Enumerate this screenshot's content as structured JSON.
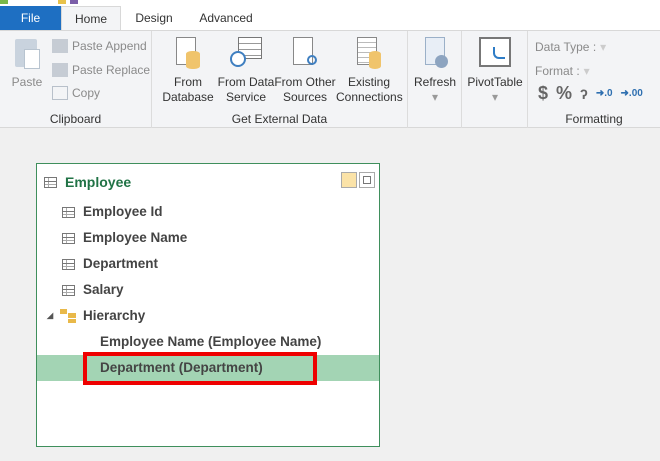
{
  "tabs": {
    "file": "File",
    "home": "Home",
    "design": "Design",
    "advanced": "Advanced"
  },
  "clipboard": {
    "paste": "Paste",
    "paste_append": "Paste Append",
    "paste_replace": "Paste Replace",
    "copy": "Copy",
    "label": "Clipboard"
  },
  "external": {
    "from_database": [
      "From",
      "Database"
    ],
    "from_data_service": [
      "From Data",
      "Service"
    ],
    "from_other": [
      "From Other",
      "Sources"
    ],
    "existing": [
      "Existing",
      "Connections"
    ],
    "label": "Get External Data"
  },
  "refresh": "Refresh",
  "pivot": "PivotTable",
  "formatting": {
    "data_type": "Data Type :",
    "format": "Format :",
    "label": "Formatting",
    "currency": "$",
    "percent": "%",
    "comma": "ʔ"
  },
  "table": {
    "name": "Employee",
    "columns": [
      "Employee Id",
      "Employee Name",
      "Department",
      "Salary"
    ],
    "hierarchy": "Hierarchy",
    "levels": [
      "Employee Name  (Employee Name)",
      "Department  (Department)"
    ]
  },
  "colors": {
    "accent": "#217346",
    "selection": "#a3d4b4",
    "highlight_box": "#e00000",
    "file_tab": "#1e6fc2"
  }
}
